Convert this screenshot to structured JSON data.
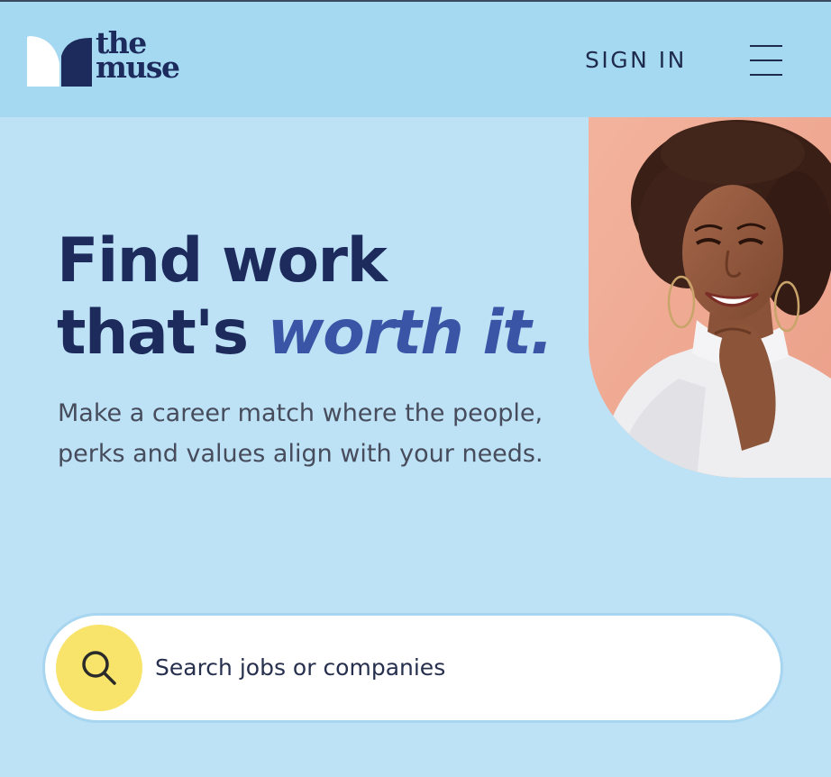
{
  "header": {
    "logo": {
      "line1": "the",
      "line2": "muse"
    },
    "sign_in_label": "SIGN IN",
    "menu_icon": "hamburger-menu-icon"
  },
  "hero": {
    "headline_line1": "Find work",
    "headline_line2_plain": "that's ",
    "headline_line2_accent": "worth it.",
    "subtext": "Make a career match where the people, perks and values align with your needs.",
    "photo_icon": "smiling-woman-photo"
  },
  "search": {
    "placeholder": "Search jobs or companies",
    "value": "",
    "button_icon": "search-icon"
  },
  "colors": {
    "header_bg": "#a5d8f1",
    "page_bg": "#bde1f5",
    "headline": "#1c2a5c",
    "accent": "#3b55a6",
    "search_button": "#f8e46a"
  }
}
